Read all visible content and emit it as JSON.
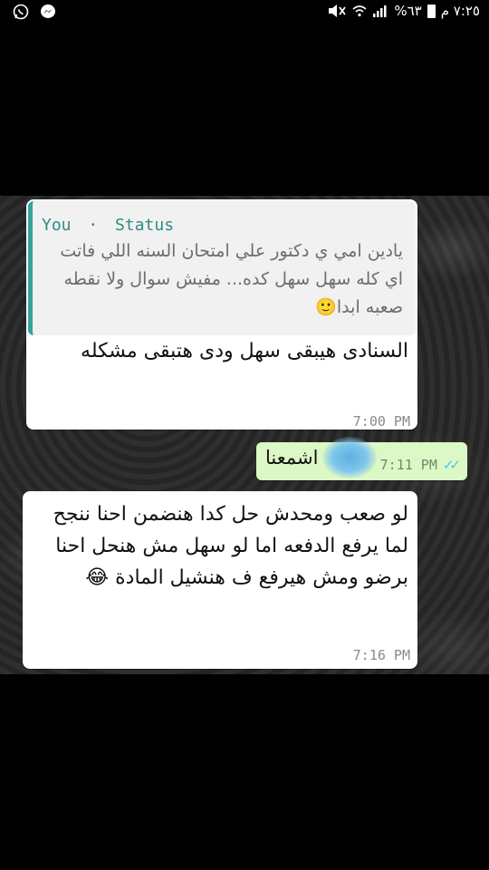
{
  "status_bar": {
    "time": "٧:٢٥ م",
    "battery_percent": "%٦٣",
    "icons": [
      "battery-icon",
      "signal-icon",
      "wifi-icon",
      "mute-icon",
      "messenger-icon",
      "whatsapp-icon"
    ]
  },
  "messages": [
    {
      "direction": "incoming",
      "quote": {
        "sender": "You",
        "separator": "·",
        "source": "Status",
        "text": "يادين امي ي دكتور علي امتحان السنه اللي فاتت اي كله سهل سهل كده... مفيش سوال ولا نقطه صعبه ابدا🙂"
      },
      "text": "السنادى هيبقى سهل ودى هتبقى مشكله",
      "time": "7:00 PM"
    },
    {
      "direction": "outgoing",
      "text": "اشمعنا",
      "time": "7:11 PM",
      "ticks": "✓✓"
    },
    {
      "direction": "incoming",
      "text": "لو صعب ومحدش حل كدا هنضمن احنا ننجح لما يرفع الدفعه اما لو سهل مش هنحل احنا برضو ومش هيرفع ف هنشيل المادة 😂",
      "time": "7:16 PM"
    }
  ],
  "colors": {
    "quote_accent": "#35a49b",
    "outgoing_bubble": "#dcf8c6",
    "read_ticks": "#4fc3f7"
  }
}
